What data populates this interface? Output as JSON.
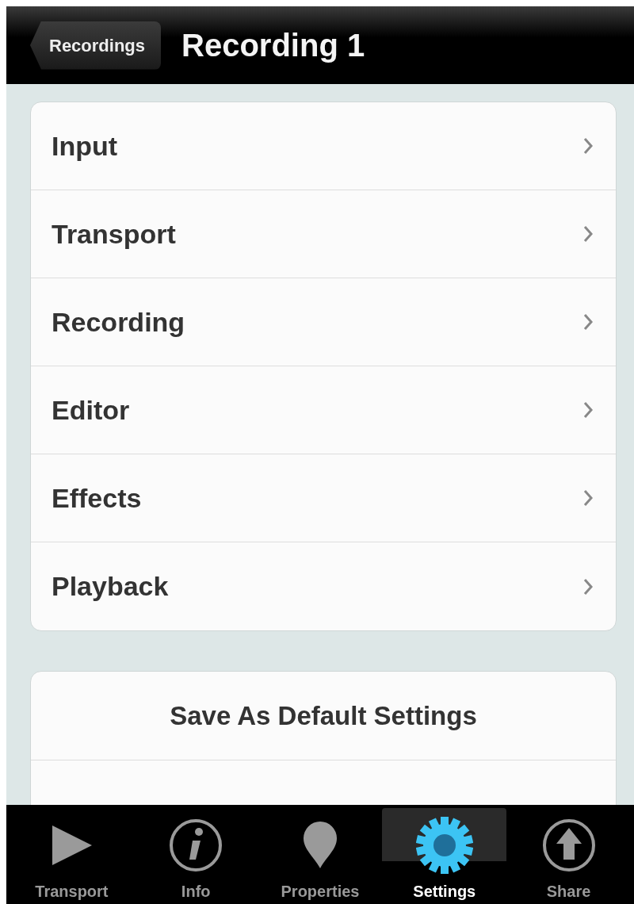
{
  "nav_bar": {
    "back_button": "Recordings",
    "title": "Recording 1"
  },
  "menu": [
    {
      "label": "Input"
    },
    {
      "label": "Transport"
    },
    {
      "label": "Recording"
    },
    {
      "label": "Editor"
    },
    {
      "label": "Effects"
    },
    {
      "label": "Playback"
    }
  ],
  "actions": [
    {
      "label": "Save As Default Settings"
    }
  ],
  "tab_bar": [
    {
      "label": "Transport",
      "kind": "play",
      "selected": false
    },
    {
      "label": "Info",
      "kind": "info",
      "selected": false
    },
    {
      "label": "Properties",
      "kind": "pin",
      "selected": false
    },
    {
      "label": "Settings",
      "kind": "gear",
      "selected": true
    },
    {
      "label": "Share",
      "kind": "share",
      "selected": false
    }
  ]
}
